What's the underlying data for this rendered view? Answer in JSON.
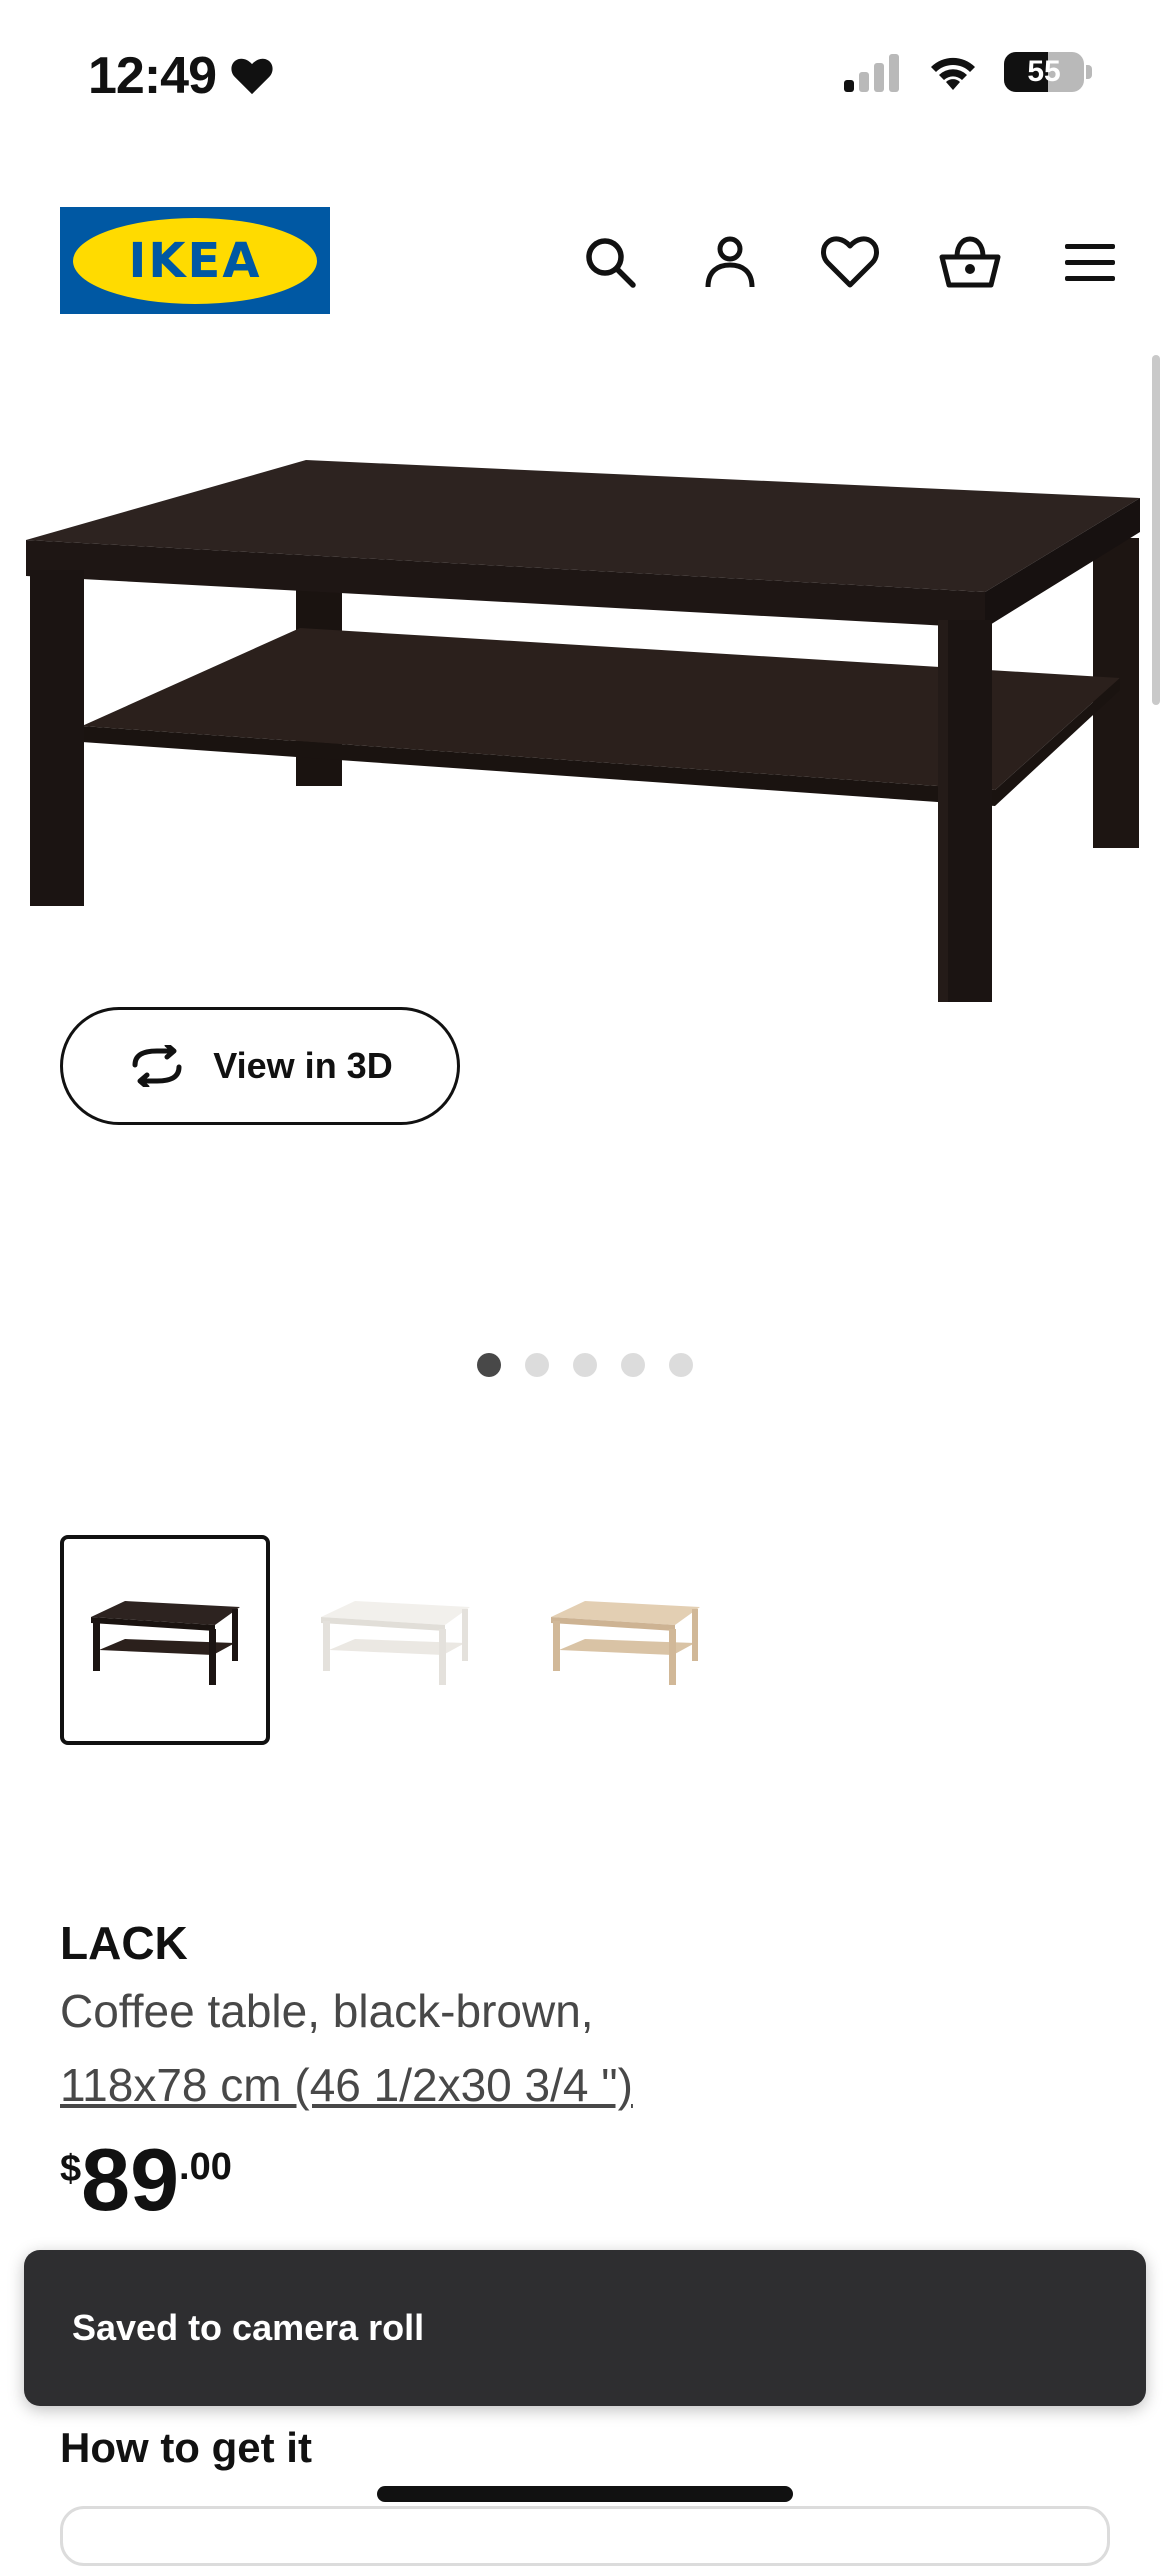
{
  "status_bar": {
    "time": "12:49",
    "battery_level": "55",
    "battery_fraction": 0.55
  },
  "header": {
    "logo_text": "IKEA",
    "icons": [
      "search-icon",
      "account-icon",
      "heart-icon",
      "basket-icon",
      "menu-icon"
    ]
  },
  "product_gallery": {
    "view_3d_label": "View in 3D",
    "dots_total": 5,
    "active_dot": 1,
    "color_variants": [
      {
        "name": "black-brown",
        "color": "#2a1f1c",
        "selected": true
      },
      {
        "name": "white",
        "color": "#f2f0ec",
        "selected": false
      },
      {
        "name": "white stained oak effect",
        "color": "#d9c3a5",
        "selected": false
      }
    ]
  },
  "product": {
    "name": "LACK",
    "description": "Coffee table, black-brown,",
    "size": "118x78 cm (46 1/2x30 3/4 \")",
    "price_currency": "$",
    "price_integer": "89",
    "price_decimal": ".00"
  },
  "toast": {
    "message": "Saved to camera roll"
  },
  "how_to_get": {
    "title": "How to get it"
  },
  "colors": {
    "ikea_blue": "#0058a3",
    "ikea_yellow": "#ffdb00",
    "table_dark": "#2a1f1c",
    "toast_bg": "#2e2e30"
  }
}
